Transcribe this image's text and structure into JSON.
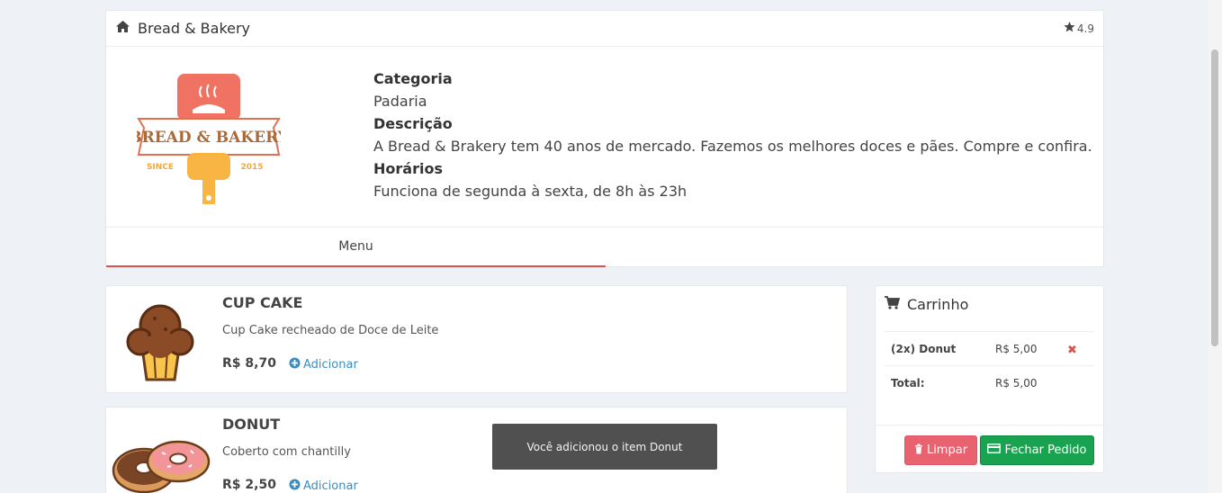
{
  "store": {
    "title": "Bread & Bakery",
    "rating": "4.9",
    "logo": {
      "brand_text": "BREAD & BAKERY",
      "since_left": "SINCE",
      "since_right": "2015",
      "icon": "bakery-logo"
    },
    "info": {
      "category_label": "Categoria",
      "category_value": "Padaria",
      "description_label": "Descrição",
      "description_value": "A Bread & Brakery tem 40 anos de mercado. Fazemos os melhores doces e pães. Compre e confira.",
      "hours_label": "Horários",
      "hours_value": "Funciona de segunda à sexta, de 8h às 23h"
    },
    "tabs": [
      {
        "label": "Menu",
        "active": true
      }
    ],
    "accent_color": "#d9534f"
  },
  "products": [
    {
      "name": "CUP CAKE",
      "description": "Cup Cake recheado de Doce de Leite",
      "price": "R$ 8,70",
      "add_label": "Adicionar",
      "image_icon": "cupcake-icon"
    },
    {
      "name": "DONUT",
      "description": "Coberto com chantilly",
      "price": "R$ 2,50",
      "add_label": "Adicionar",
      "image_icon": "donut-icon"
    }
  ],
  "cart": {
    "title": "Carrinho",
    "items": [
      {
        "label": "(2x) Donut",
        "price": "R$ 5,00"
      }
    ],
    "total_label": "Total:",
    "total_value": "R$ 5,00",
    "clear_label": "Limpar",
    "order_label": "Fechar Pedido",
    "colors": {
      "clear": "#e8636f",
      "order": "#19a350"
    }
  },
  "toast": {
    "message": "Você adicionou o item Donut"
  }
}
